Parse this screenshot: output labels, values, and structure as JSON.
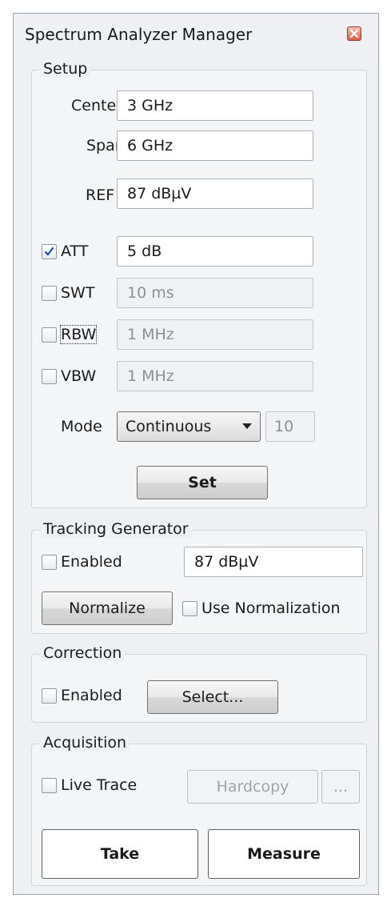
{
  "window": {
    "title": "Spectrum Analyzer Manager"
  },
  "setup": {
    "label": "Setup",
    "center": {
      "label": "Center",
      "value": "3 GHz"
    },
    "span": {
      "label": "Span",
      "value": "6 GHz"
    },
    "ref": {
      "label": "REF",
      "value": "87 dBµV"
    },
    "att": {
      "label": "ATT",
      "value": "5 dB",
      "checked": true
    },
    "swt": {
      "label": "SWT",
      "value": "10 ms",
      "checked": false
    },
    "rbw": {
      "label": "RBW",
      "value": "1 MHz",
      "checked": false
    },
    "vbw": {
      "label": "VBW",
      "value": "1 MHz",
      "checked": false
    },
    "mode": {
      "label": "Mode",
      "selected": "Continuous",
      "count": "10"
    },
    "set_label": "Set"
  },
  "tracking": {
    "label": "Tracking Generator",
    "enabled_label": "Enabled",
    "level_value": "87 dBµV",
    "normalize_label": "Normalize",
    "use_normalization_label": "Use Normalization"
  },
  "correction": {
    "label": "Correction",
    "enabled_label": "Enabled",
    "select_label": "Select..."
  },
  "acquisition": {
    "label": "Acquisition",
    "live_trace_label": "Live Trace",
    "hardcopy_label": "Hardcopy",
    "more_label": "...",
    "take_label": "Take",
    "measure_label": "Measure"
  }
}
